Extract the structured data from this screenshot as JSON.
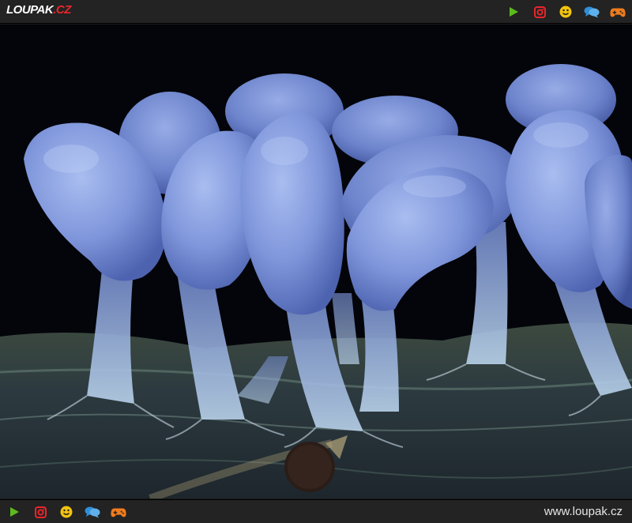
{
  "header": {
    "logo_main": "LOUPAK",
    "logo_tld": ".CZ",
    "icons": [
      "play-icon",
      "instagram-icon",
      "smiley-icon",
      "chat-icon",
      "gamepad-icon"
    ]
  },
  "footer": {
    "icons": [
      "play-icon",
      "instagram-icon",
      "smiley-icon",
      "chat-icon",
      "gamepad-icon"
    ],
    "site_url": "www.loupak.cz"
  },
  "colors": {
    "bar_background": "#232323",
    "logo_accent": "#e8262b",
    "play_green": "#5dbb1e",
    "instagram_red": "#e8262b",
    "smiley_yellow": "#f2c30f",
    "chat_blue": "#2f8fd8",
    "gamepad_orange": "#f07c1e"
  },
  "photo": {
    "subject": "slime-mold-fruiting-bodies"
  }
}
